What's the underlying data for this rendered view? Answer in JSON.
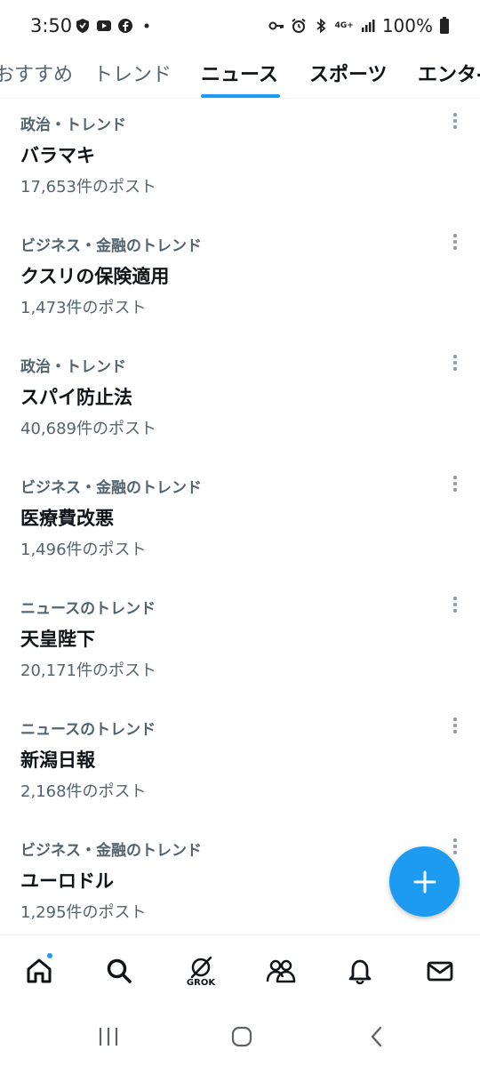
{
  "status_bar": {
    "time": "3:50",
    "battery": "100%",
    "network": "4G+"
  },
  "tabs": [
    {
      "label": "おすすめ",
      "active": false
    },
    {
      "label": "トレンド",
      "active": false
    },
    {
      "label": "ニュース",
      "active": true
    },
    {
      "label": "スポーツ",
      "active": false
    },
    {
      "label": "エンタ-",
      "active": false
    }
  ],
  "trends": [
    {
      "category": "政治・トレンド",
      "title": "バラマキ",
      "count": "17,653件のポスト"
    },
    {
      "category": "ビジネス・金融のトレンド",
      "title": "クスリの保険適用",
      "count": "1,473件のポスト"
    },
    {
      "category": "政治・トレンド",
      "title": "スパイ防止法",
      "count": "40,689件のポスト"
    },
    {
      "category": "ビジネス・金融のトレンド",
      "title": "医療費改悪",
      "count": "1,496件のポスト"
    },
    {
      "category": "ニュースのトレンド",
      "title": "天皇陛下",
      "count": "20,171件のポスト"
    },
    {
      "category": "ニュースのトレンド",
      "title": "新潟日報",
      "count": "2,168件のポスト"
    },
    {
      "category": "ビジネス・金融のトレンド",
      "title": "ユーロドル",
      "count": "1,295件のポスト"
    }
  ],
  "bottom_nav": {
    "home_icon": "home-icon",
    "search_icon": "search-icon",
    "grok_label": "GROK",
    "communities_icon": "people-icon",
    "notifications_icon": "bell-icon",
    "messages_icon": "mail-icon"
  },
  "colors": {
    "accent": "#1d9bf0",
    "text_primary": "#0f1419",
    "text_secondary": "#536471"
  }
}
